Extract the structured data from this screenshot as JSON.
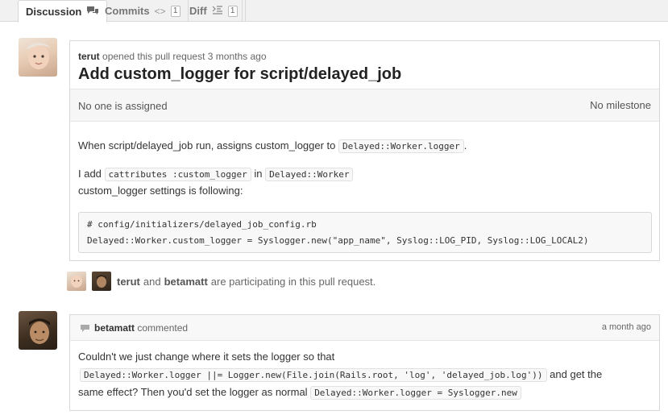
{
  "tabs": [
    {
      "label": "Discussion",
      "icon": "comment-discussion-icon"
    },
    {
      "label": "Commits",
      "icon": "code-icon",
      "count": "1"
    },
    {
      "label": "Diff",
      "icon": "diff-icon",
      "count": "1"
    }
  ],
  "pull_request": {
    "author": "terut",
    "opened_text": "opened this pull request 3 months ago",
    "title": "Add custom_logger for script/delayed_job",
    "assignee_text": "No one is assigned",
    "milestone_text": "No milestone",
    "body": {
      "p1_text": "When script/delayed_job run, assigns custom_logger to",
      "p1_code": "Delayed::Worker.logger",
      "p1_end": ".",
      "p2_text": "I add",
      "p2_code1": "cattributes :custom_logger",
      "p2_mid": "in",
      "p2_code2": "Delayed::Worker",
      "p2_line2": "custom_logger settings is following:",
      "code_line1": "# config/initializers/delayed_job_config.rb",
      "code_line2": "Delayed::Worker.custom_logger = Syslogger.new(\"app_name\", Syslog::LOG_PID, Syslog::LOG_LOCAL2)"
    }
  },
  "participants": {
    "user1": "terut",
    "and": "and",
    "user2": "betamatt",
    "suffix": "are participating in this pull request."
  },
  "comment": {
    "author": "betamatt",
    "action": "commented",
    "time": "a month ago",
    "line1": "Couldn't we just change where it sets the logger so that",
    "code1": "Delayed::Worker.logger ||= Logger.new(File.join(Rails.root, 'log', 'delayed_job.log'))",
    "line2_end": "and get the",
    "line3_start": "same effect? Then you'd set the logger as normal",
    "code2": "Delayed::Worker.logger = Syslogger.new"
  }
}
